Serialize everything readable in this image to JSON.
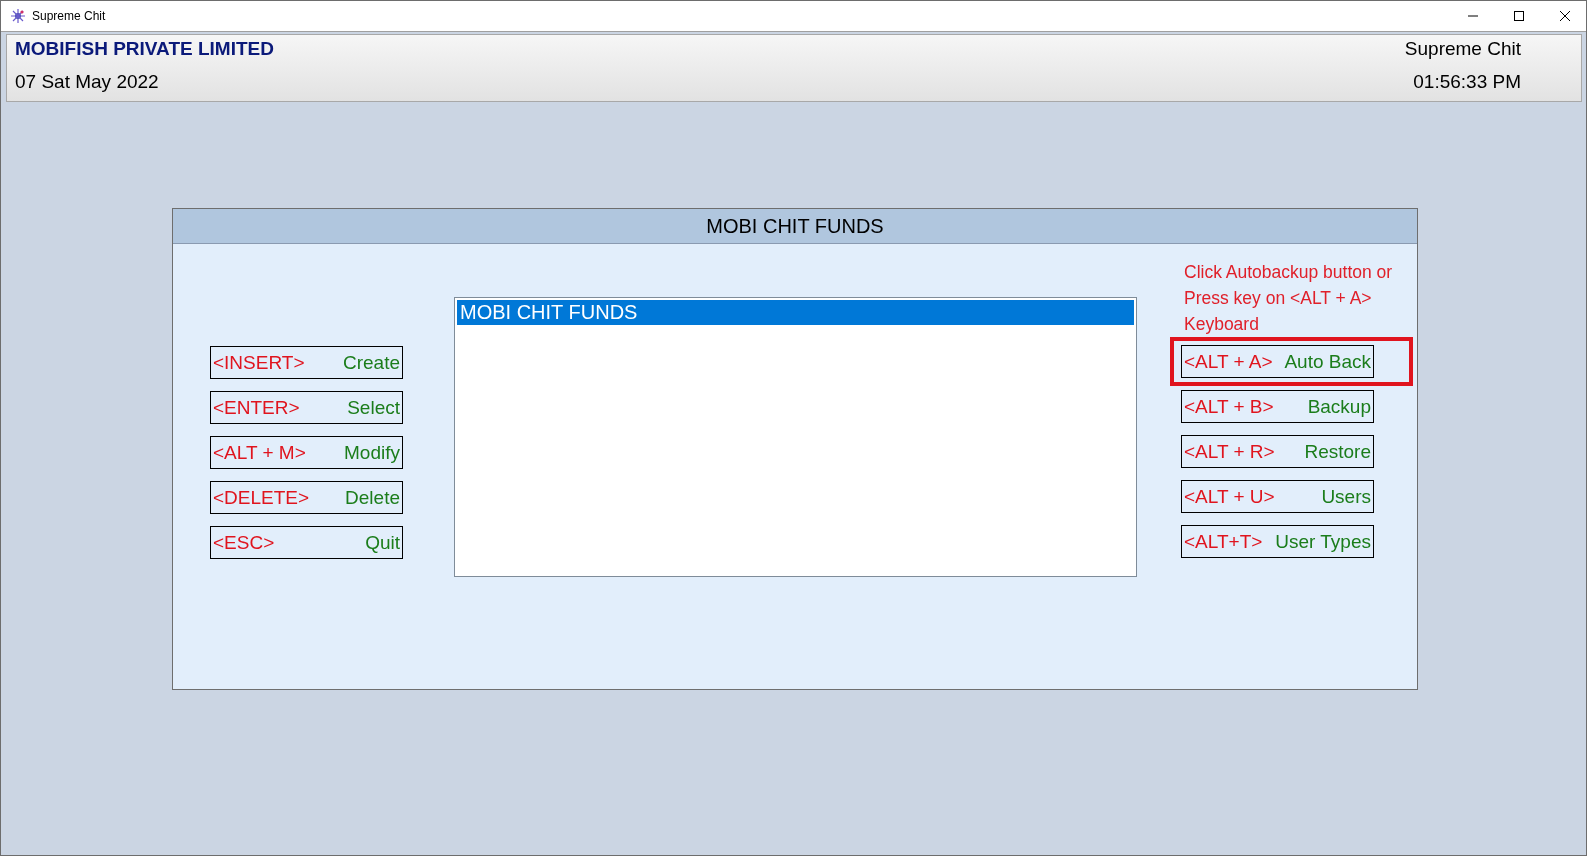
{
  "window": {
    "title": "Supreme Chit"
  },
  "header": {
    "company": "MOBIFISH PRIVATE LIMITED",
    "date": "07 Sat May 2022",
    "app_name": "Supreme Chit",
    "time": "01:56:33 PM"
  },
  "dialog": {
    "title": "MOBI CHIT FUNDS",
    "list": [
      {
        "label": "MOBI CHIT FUNDS",
        "selected": true
      }
    ],
    "left_buttons": [
      {
        "key": "<INSERT>",
        "action": "Create",
        "highlighted": false
      },
      {
        "key": "<ENTER>",
        "action": "Select",
        "highlighted": false
      },
      {
        "key": "<ALT + M>",
        "action": "Modify",
        "highlighted": false
      },
      {
        "key": "<DELETE>",
        "action": "Delete",
        "highlighted": false
      },
      {
        "key": "<ESC>",
        "action": "Quit",
        "highlighted": false
      }
    ],
    "hint": "Click Autobackup button or Press key on <ALT + A> Keyboard",
    "right_buttons": [
      {
        "key": "<ALT + A>",
        "action": "Auto Back",
        "highlighted": true
      },
      {
        "key": "<ALT + B>",
        "action": "Backup",
        "highlighted": false
      },
      {
        "key": "<ALT + R>",
        "action": "Restore",
        "highlighted": false
      },
      {
        "key": "<ALT + U>",
        "action": "Users",
        "highlighted": false
      },
      {
        "key": "<ALT+T>",
        "action": "User Types",
        "highlighted": false
      }
    ]
  }
}
